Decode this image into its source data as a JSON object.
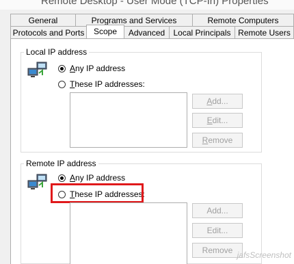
{
  "window": {
    "title": "Remote Desktop - User Mode (TCP-In) Properties"
  },
  "tabs_row1": [
    "General",
    "Programs and Services",
    "Remote Computers"
  ],
  "tabs_row2": [
    "Protocols and Ports",
    "Scope",
    "Advanced",
    "Local Principals",
    "Remote Users"
  ],
  "active_tab": "Scope",
  "local": {
    "title": "Local IP address",
    "any_prefix": "A",
    "any_rest": "ny IP address",
    "these_prefix": "T",
    "these_rest": "hese IP addresses:",
    "selected": "any",
    "add_prefix": "A",
    "add_rest": "dd...",
    "edit_prefix": "E",
    "edit_rest": "dit...",
    "remove_prefix": "R",
    "remove_rest": "emove",
    "addresses": []
  },
  "remote": {
    "title": "Remote IP address",
    "any_prefix": "A",
    "any_rest": "ny IP address",
    "these_prefix": "T",
    "these_rest": "hese IP addresses:",
    "selected": "any",
    "add_prefix": "",
    "add_rest": "Add...",
    "edit_prefix": "",
    "edit_rest": "Edit...",
    "remove_prefix": "",
    "remove_rest": "Remove",
    "addresses": []
  },
  "watermark": "jafsScreenshot",
  "colors": {
    "highlight": "#e0191b",
    "background": "#f0f0f0",
    "panel": "#ffffff"
  },
  "icons": {
    "network": "network-computers-icon"
  }
}
